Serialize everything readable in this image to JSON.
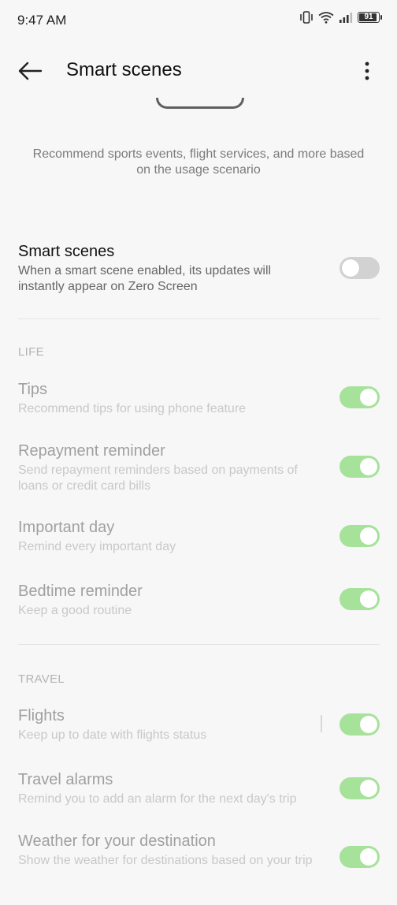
{
  "status": {
    "time": "9:47 AM",
    "battery": "91"
  },
  "header": {
    "title": "Smart scenes"
  },
  "intro": "Recommend sports events, flight services, and more based on the usage scenario",
  "main_setting": {
    "title": "Smart scenes",
    "description": "When a smart scene enabled, its updates will instantly appear on Zero Screen",
    "enabled": false
  },
  "sections": {
    "life": {
      "label": "LIFE",
      "items": [
        {
          "title": "Tips",
          "description": "Recommend tips for using phone feature",
          "enabled": true
        },
        {
          "title": "Repayment reminder",
          "description": "Send repayment reminders based on payments of loans or credit card bills",
          "enabled": true
        },
        {
          "title": "Important day",
          "description": "Remind every important day",
          "enabled": true
        },
        {
          "title": "Bedtime reminder",
          "description": "Keep a good routine",
          "enabled": true
        }
      ]
    },
    "travel": {
      "label": "TRAVEL",
      "items": [
        {
          "title": "Flights",
          "description": "Keep up to date with flights status",
          "enabled": true
        },
        {
          "title": "Travel alarms",
          "description": "Remind you to add an alarm for the next day's trip",
          "enabled": true
        },
        {
          "title": "Weather for your destination",
          "description": "Show the weather for destinations based on your trip",
          "enabled": true
        }
      ]
    }
  },
  "colors": {
    "toggle_on": "#a6e29a",
    "toggle_off": "#d2d2d2",
    "background": "#f7f7f7"
  }
}
